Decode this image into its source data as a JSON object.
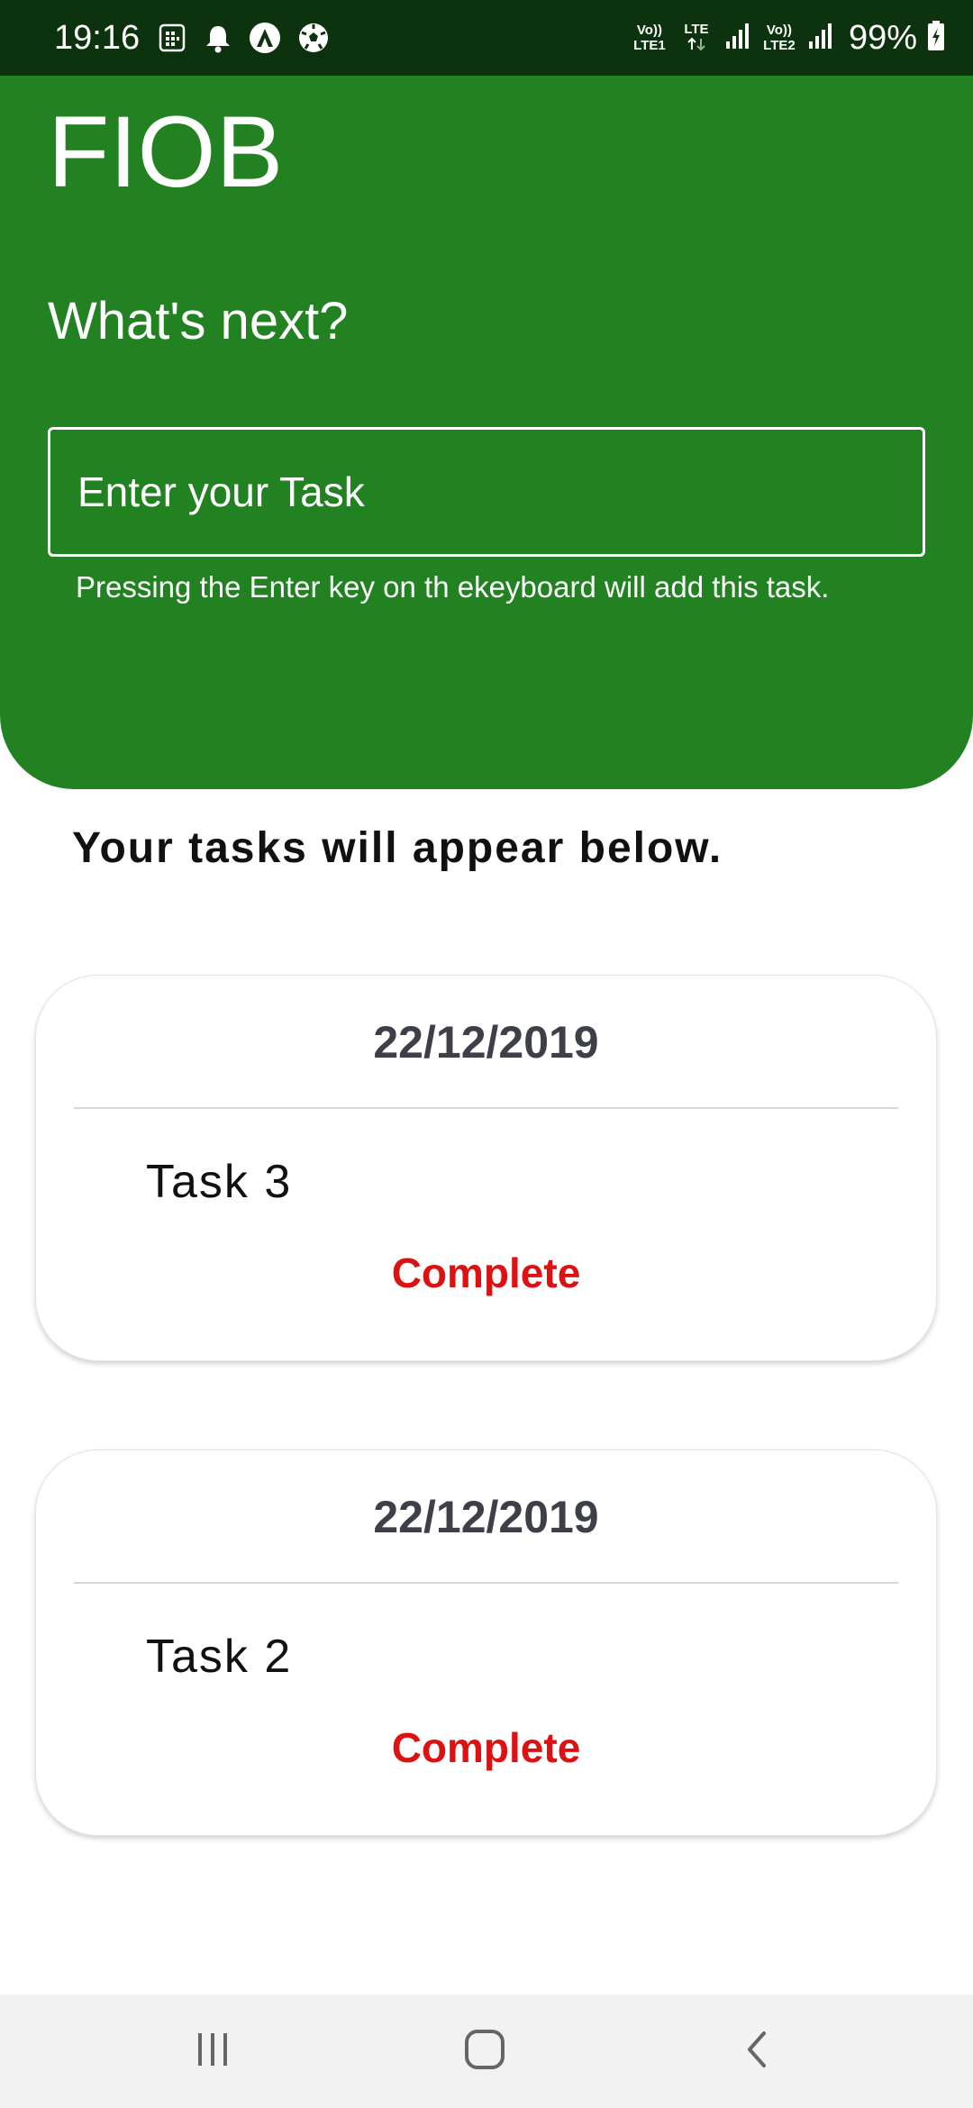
{
  "status_bar": {
    "time": "19:16",
    "sim1_label_top": "Vo))",
    "sim1_label_bottom": "LTE1",
    "lte_label": "LTE",
    "sim2_label_top": "Vo))",
    "sim2_label_bottom": "LTE2",
    "battery_percent": "99%",
    "icons": [
      "sim-card-icon",
      "bell-icon",
      "app-a-icon",
      "soccer-ball-icon",
      "signal-icon",
      "battery-charging-icon"
    ]
  },
  "header": {
    "app_title": "FIOB",
    "prompt": "What's next?",
    "task_input": {
      "value": "",
      "placeholder": "Enter your Task"
    },
    "helper_text": "Pressing the Enter key on th ekeyboard will add this task."
  },
  "main": {
    "heading": "Your tasks will appear below.",
    "tasks": [
      {
        "date": "22/12/2019",
        "name": "Task 3",
        "action_label": "Complete"
      },
      {
        "date": "22/12/2019",
        "name": "Task 2",
        "action_label": "Complete"
      }
    ]
  },
  "nav_bar": {
    "icons": [
      "recent-apps-icon",
      "home-icon",
      "back-icon"
    ]
  },
  "colors": {
    "status_bar": "#0c330d",
    "header_green": "#228222",
    "complete_red": "#dd1111",
    "date_text": "#3d4048",
    "nav_bar": "#f2f2f2"
  }
}
